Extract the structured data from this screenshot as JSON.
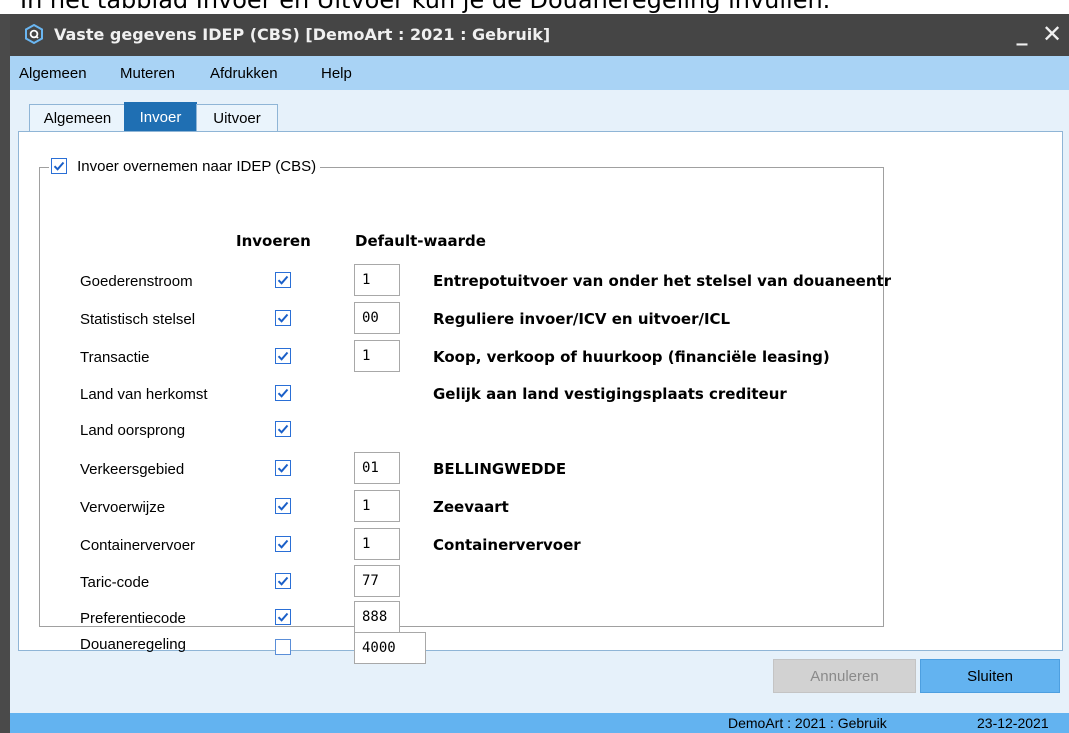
{
  "caption": "In het tabblad Invoer en Uitvoer kun je de Douaneregeling invullen.",
  "window": {
    "title": "Vaste gegevens IDEP (CBS)  [DemoArt : 2021 : Gebruik]",
    "minimize": "_",
    "close": "✕"
  },
  "menu": [
    "Algemeen",
    "Muteren",
    "Afdrukken",
    "Help"
  ],
  "tabs": [
    "Algemeen",
    "Invoer",
    "Uitvoer"
  ],
  "active_tab": "Invoer",
  "group": {
    "label": "Invoer overnemen naar IDEP (CBS)",
    "checked": true
  },
  "columns": {
    "invoeren": "Invoeren",
    "default": "Default-waarde"
  },
  "rows": [
    {
      "label": "Goederenstroom",
      "checked": true,
      "value": "1",
      "description": "Entrepotuitvoer van onder het stelsel van douaneentrepot"
    },
    {
      "label": "Statistisch stelsel",
      "checked": true,
      "value": "00",
      "description": "Reguliere invoer/ICV en uitvoer/ICL"
    },
    {
      "label": "Transactie",
      "checked": true,
      "value": "1",
      "description": "Koop, verkoop of huurkoop (financiële leasing)"
    },
    {
      "label": "Land van herkomst",
      "checked": true,
      "value": "",
      "description": "Gelijk aan land vestigingsplaats crediteur"
    },
    {
      "label": "Land oorsprong",
      "checked": true,
      "value": "",
      "description": ""
    },
    {
      "label": "Verkeersgebied",
      "checked": true,
      "value": "01",
      "description": "BELLINGWEDDE"
    },
    {
      "label": "Vervoerwijze",
      "checked": true,
      "value": "1",
      "description": "Zeevaart"
    },
    {
      "label": "Containervervoer",
      "checked": true,
      "value": "1",
      "description": "Containervervoer"
    },
    {
      "label": "Taric-code",
      "checked": true,
      "value": "77",
      "description": ""
    },
    {
      "label": "Preferentiecode",
      "checked": true,
      "value": "888",
      "description": ""
    },
    {
      "label": "Douaneregeling",
      "checked": false,
      "value": "4000",
      "description": ""
    }
  ],
  "buttons": {
    "cancel": "Annuleren",
    "close": "Sluiten"
  },
  "status": {
    "context": "DemoArt : 2021 : Gebruik",
    "date": "23-12-2021"
  },
  "colors": {
    "titlebar": "#454545",
    "menubar": "#a9d3f5",
    "accent": "#63b3f0",
    "active_tab": "#1f6fb3",
    "checkbox": "#2a6fd6"
  }
}
